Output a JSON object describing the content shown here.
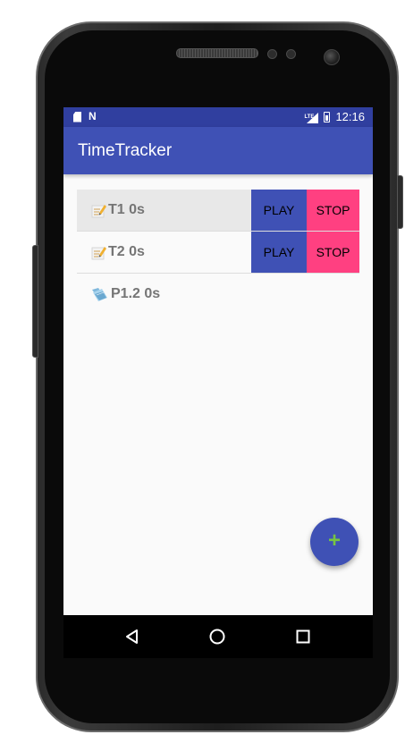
{
  "status_bar": {
    "time": "12:16",
    "network_label": "LTE",
    "icons": [
      "sd-card-icon",
      "n-notification-icon",
      "lte-signal-icon",
      "battery-icon"
    ]
  },
  "app_bar": {
    "title": "TimeTracker"
  },
  "list": {
    "items": [
      {
        "type": "task",
        "icon": "task-pencil-icon",
        "label": "T1 0s",
        "selected": true,
        "play_label": "PLAY",
        "stop_label": "STOP"
      },
      {
        "type": "task",
        "icon": "task-pencil-icon",
        "label": "T2 0s",
        "selected": false,
        "play_label": "PLAY",
        "stop_label": "STOP"
      },
      {
        "type": "project",
        "icon": "project-folder-icon",
        "label": "P1.2 0s"
      }
    ]
  },
  "fab": {
    "symbol": "+",
    "icon": "add-icon"
  },
  "nav_bar": {
    "icons": [
      "back-icon",
      "home-icon",
      "recents-icon"
    ]
  },
  "colors": {
    "primary": "#3f51b5",
    "primary_dark": "#303f9f",
    "accent": "#ff4081",
    "fab_plus": "#76c442",
    "label_gray": "#757575"
  }
}
